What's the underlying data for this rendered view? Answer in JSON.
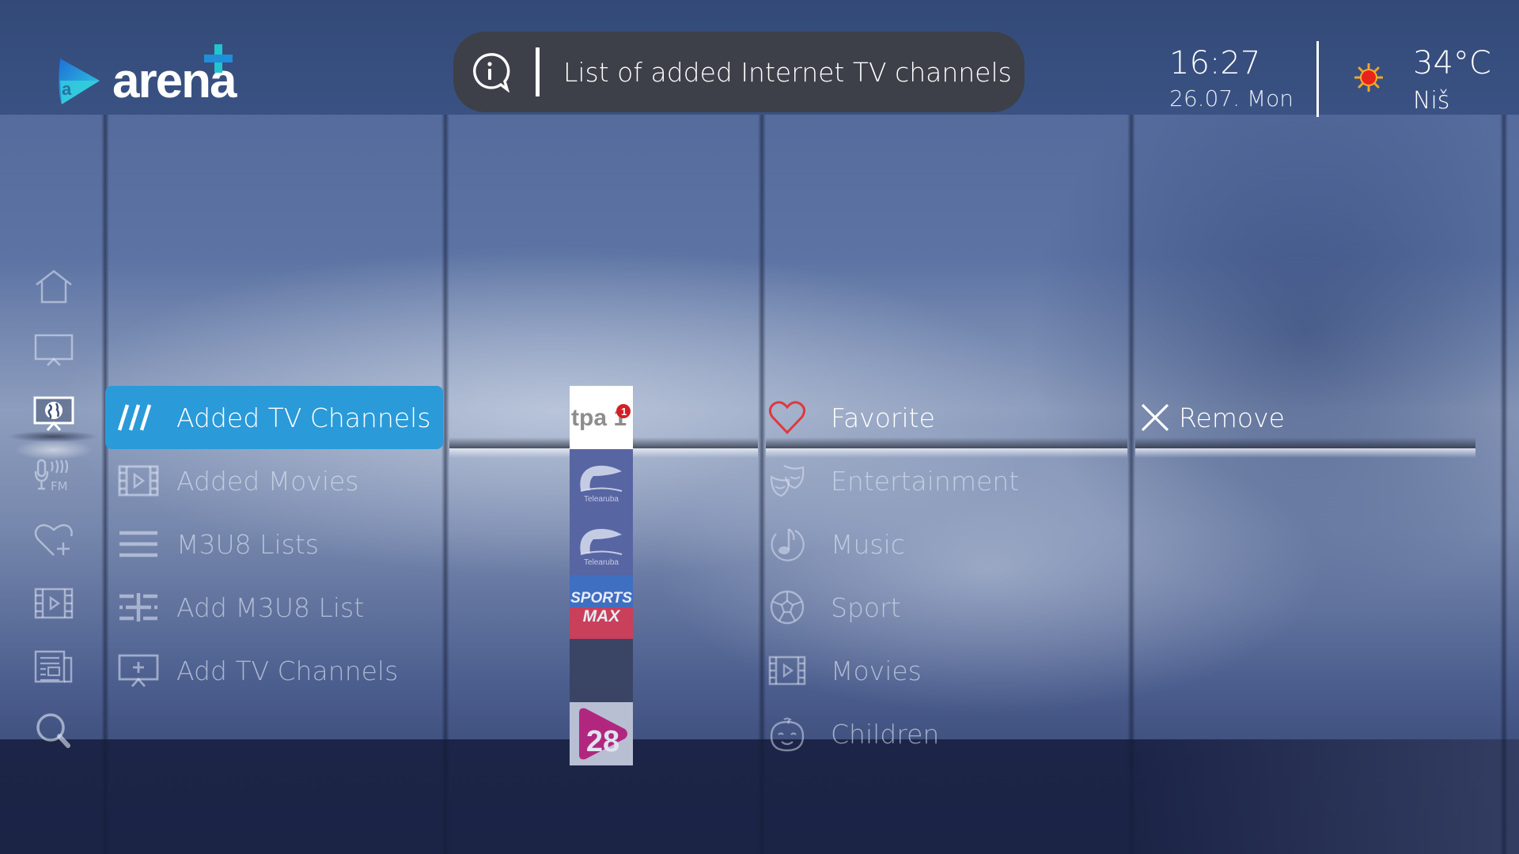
{
  "app": {
    "brand": "arena",
    "brand_icon": "arena-plus-logo"
  },
  "info_bar": {
    "icon": "info-bubble-icon",
    "text": "List of added Internet TV channels"
  },
  "clock": {
    "time": "16:27",
    "date": "26.07. Mon"
  },
  "weather": {
    "icon": "sunny-icon",
    "temperature": "34°C",
    "city": "Niš"
  },
  "colors": {
    "accent": "#2a9ad9",
    "favorite": "#e0383e",
    "info_bar_bg": "#3d4048"
  },
  "left_rail": {
    "items": [
      {
        "id": "home",
        "icon": "home-icon"
      },
      {
        "id": "tv",
        "icon": "tv-icon"
      },
      {
        "id": "internet-tv",
        "icon": "globe-tv-icon",
        "selected": true
      },
      {
        "id": "radio",
        "icon": "fm-radio-icon"
      },
      {
        "id": "favorites",
        "icon": "heart-plus-icon"
      },
      {
        "id": "movies",
        "icon": "film-icon"
      },
      {
        "id": "news",
        "icon": "newspaper-icon"
      },
      {
        "id": "search",
        "icon": "search-icon"
      }
    ]
  },
  "submenu": {
    "items": [
      {
        "label": "Added TV Channels",
        "icon": "slashes-icon",
        "selected": true
      },
      {
        "label": "Added Movies",
        "icon": "film-icon"
      },
      {
        "label": "M3U8 Lists",
        "icon": "list-icon"
      },
      {
        "label": "Add M3U8 List",
        "icon": "list-add-icon"
      },
      {
        "label": "Add TV Channels",
        "icon": "tv-add-icon"
      }
    ]
  },
  "channels": [
    {
      "name": "tpa 1",
      "badge": "1",
      "selected": true
    },
    {
      "name": "Telearuba"
    },
    {
      "name": "Telearuba"
    },
    {
      "name": "Sports Max",
      "line1": "SPORTS",
      "line2": "MAX"
    },
    {
      "name": ""
    },
    {
      "name": "28",
      "label": "28"
    }
  ],
  "categories": {
    "items": [
      {
        "label": "Favorite",
        "icon": "heart-icon",
        "selected": true
      },
      {
        "label": "Entertainment",
        "icon": "theater-masks-icon"
      },
      {
        "label": "Music",
        "icon": "music-note-icon"
      },
      {
        "label": "Sport",
        "icon": "soccer-ball-icon"
      },
      {
        "label": "Movies",
        "icon": "film-icon"
      },
      {
        "label": "Children",
        "icon": "baby-face-icon"
      }
    ]
  },
  "actions": {
    "remove_label": "Remove",
    "remove_icon": "close-icon"
  }
}
